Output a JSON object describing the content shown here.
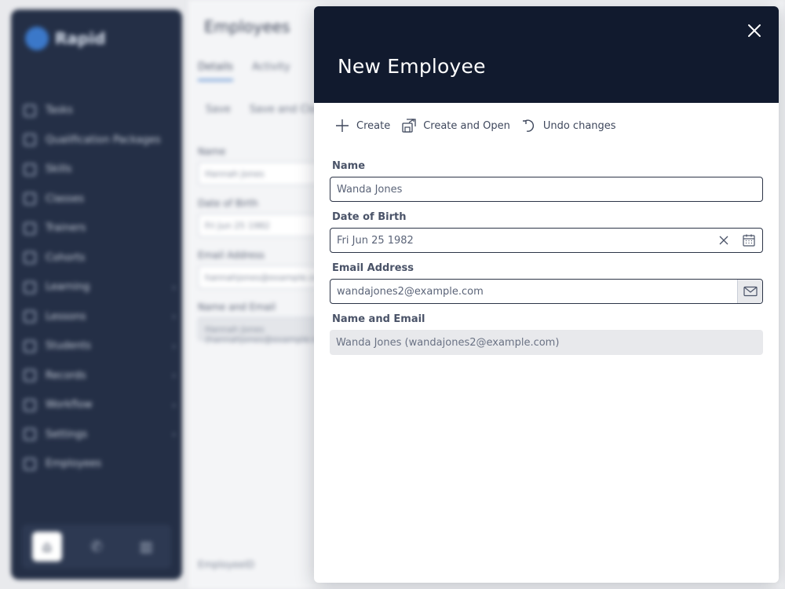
{
  "background": {
    "logo_text": "Rapid",
    "nav_items": [
      {
        "label": "Tasks",
        "chevron": false
      },
      {
        "label": "Qualification Packages",
        "chevron": false
      },
      {
        "label": "Skills",
        "chevron": false
      },
      {
        "label": "Classes",
        "chevron": false
      },
      {
        "label": "Trainers",
        "chevron": false
      },
      {
        "label": "Cohorts",
        "chevron": false
      },
      {
        "label": "Learning",
        "chevron": true
      },
      {
        "label": "Lessons",
        "chevron": true
      },
      {
        "label": "Students",
        "chevron": true
      },
      {
        "label": "Records",
        "chevron": true
      },
      {
        "label": "Workflow",
        "chevron": true
      },
      {
        "label": "Settings",
        "chevron": true
      },
      {
        "label": "Employees",
        "chevron": false
      }
    ],
    "page_title": "Employees",
    "tabs": [
      "Details",
      "Activity"
    ],
    "toolbar": [
      "Save",
      "Save and Close"
    ],
    "fields": [
      {
        "label": "Name",
        "value": "Hannah Jones"
      },
      {
        "label": "Date of Birth",
        "value": "Fri Jun 25 1982"
      },
      {
        "label": "Email Address",
        "value": "hannahjones@example.com"
      },
      {
        "label": "Name and Email",
        "value": "Hannah Jones (hannahjones@example.com)"
      }
    ],
    "footer_text": "EmployeeID"
  },
  "panel": {
    "title": "New Employee",
    "toolbar": {
      "create_label": "Create",
      "create_open_label": "Create and Open",
      "undo_label": "Undo changes"
    },
    "fields": {
      "name": {
        "label": "Name",
        "value": "Wanda Jones"
      },
      "dob": {
        "label": "Date of Birth",
        "value": "Fri Jun 25 1982"
      },
      "email": {
        "label": "Email Address",
        "value": "wandajones2@example.com"
      },
      "name_email": {
        "label": "Name and Email",
        "value": "Wanda Jones (wandajones2@example.com)"
      }
    }
  },
  "colors": {
    "header_bg": "#111a2e",
    "sidebar_bg": "#242f46",
    "accent": "#3b78c9"
  }
}
